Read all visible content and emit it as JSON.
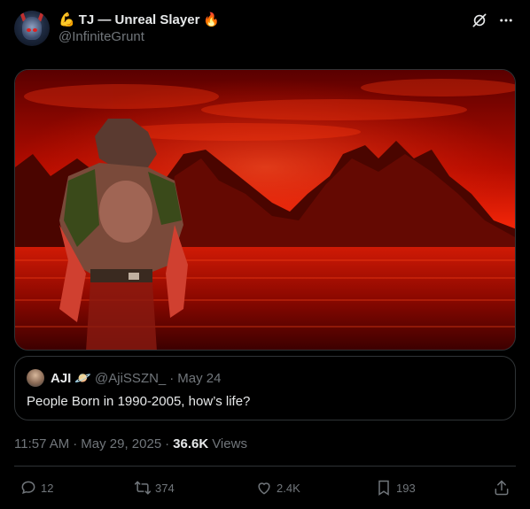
{
  "author": {
    "emoji_before": "💪",
    "display_name": "TJ — Unreal Slayer",
    "emoji_after": "🔥",
    "handle": "@InfiniteGrunt"
  },
  "top_icons": [
    "grok-icon",
    "more-icon"
  ],
  "media": {
    "description_icon": "doom-marine-image"
  },
  "quote": {
    "name": "AJI",
    "emoji": "🪐",
    "handle": "@AjiSSZN_",
    "separator": "·",
    "date": "May 24",
    "text": "People Born in 1990-2005, how’s life?"
  },
  "meta": {
    "time": "11:57 AM",
    "sep1": "·",
    "date": "May 29, 2025",
    "sep2": "·",
    "views_count": "36.6K",
    "views_label": "Views"
  },
  "actions": {
    "replies": "12",
    "reposts": "374",
    "likes": "2.4K",
    "bookmarks": "193"
  },
  "colors": {
    "background": "#000000",
    "text": "#e7e9ea",
    "muted": "#71767b",
    "border": "#2f3336"
  }
}
